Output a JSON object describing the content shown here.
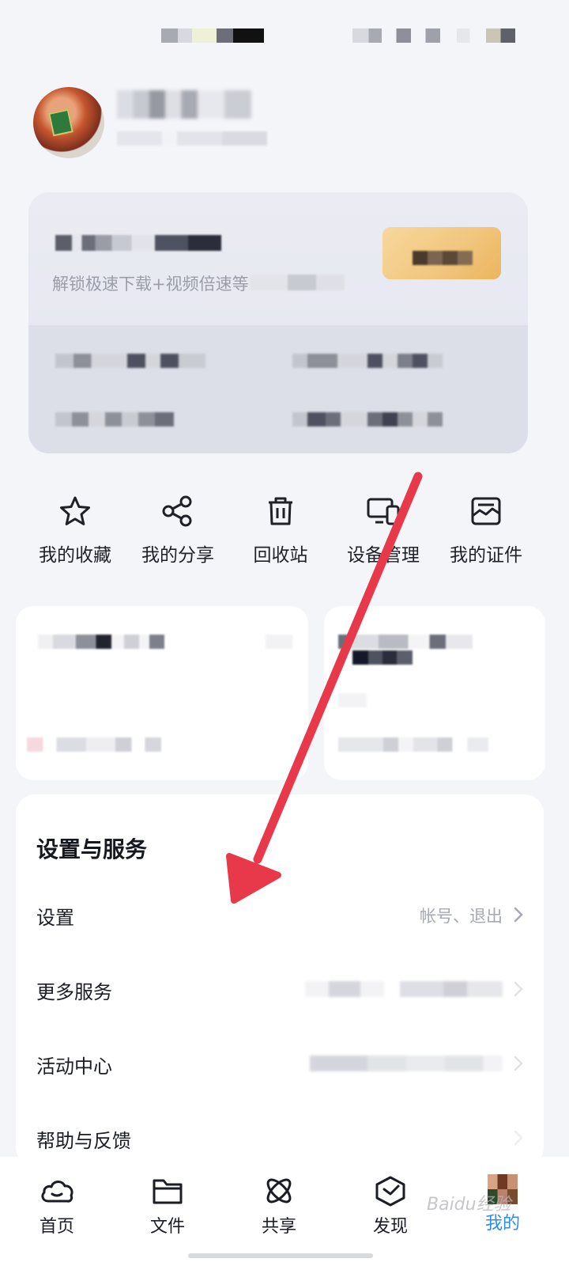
{
  "vip": {
    "subtitle": "解锁极速下载+视频倍速等"
  },
  "shortcuts": [
    {
      "label": "我的收藏",
      "icon": "star-icon"
    },
    {
      "label": "我的分享",
      "icon": "share-icon"
    },
    {
      "label": "回收站",
      "icon": "trash-icon"
    },
    {
      "label": "设备管理",
      "icon": "devices-icon"
    },
    {
      "label": "我的证件",
      "icon": "id-card-icon"
    }
  ],
  "settings": {
    "title": "设置与服务",
    "rows": [
      {
        "label": "设置",
        "value": "帐号、退出"
      },
      {
        "label": "更多服务",
        "value": ""
      },
      {
        "label": "活动中心",
        "value": ""
      },
      {
        "label": "帮助与反馈",
        "value": ""
      }
    ]
  },
  "tabbar": {
    "tabs": [
      {
        "label": "首页",
        "icon": "cloud-icon"
      },
      {
        "label": "文件",
        "icon": "folder-icon"
      },
      {
        "label": "共享",
        "icon": "atom-icon"
      },
      {
        "label": "发现",
        "icon": "cube-icon"
      },
      {
        "label": "我的",
        "icon": "avatar-icon",
        "active": true
      }
    ]
  },
  "annotation": {
    "arrow_color": "#e8394b"
  },
  "watermark": "Baidu经验"
}
